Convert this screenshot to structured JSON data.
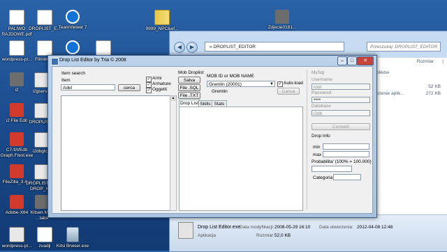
{
  "desktop": {
    "icons": [
      {
        "label": "PALIWO RAJDOWE.pdf",
        "kind": "doc"
      },
      {
        "label": "DROPLIST_E...",
        "kind": "doc"
      },
      {
        "label": "TeamViewer 7",
        "kind": "tv"
      },
      {
        "label": "9999_NPC&ef...",
        "kind": "zip"
      },
      {
        "label": "Zdjecie0181...",
        "kind": "gray"
      },
      {
        "label": "wordpress-pl...",
        "kind": "doc"
      },
      {
        "label": "Filmik003",
        "kind": "doc"
      },
      {
        "label": "",
        "kind": "tv"
      },
      {
        "label": "",
        "kind": "doc"
      },
      {
        "label": "i2",
        "kind": "gray"
      },
      {
        "label": "i2gserver",
        "kind": "exe"
      },
      {
        "label": "i2 File Edit",
        "kind": "red"
      },
      {
        "label": "DROPLIST...",
        "kind": "exe"
      },
      {
        "label": "C7-fi/t/Edit Graph.Ftest.exe",
        "kind": "red"
      },
      {
        "label": "i2dbglcut",
        "kind": "exe"
      },
      {
        "label": "FileZilla_3.4...",
        "kind": "red"
      },
      {
        "label": "DROPLIST_E... DROP_ICO",
        "kind": "exe"
      },
      {
        "label": "Adobe-X64",
        "kind": "red"
      },
      {
        "label": "Kitsen Mob ...tabs",
        "kind": "gray"
      },
      {
        "label": "wordpress-pl...",
        "kind": "exe"
      },
      {
        "label": "zuadji",
        "kind": "doc"
      },
      {
        "label": "Kitsi Brwser.exe",
        "kind": "bin"
      }
    ]
  },
  "explorer": {
    "address": "DROPLIST_EDITOR",
    "search_placeholder": "Przeszukaj: DROPLIST_EDITOR",
    "column_size": "Rozmiar",
    "rows": [
      {
        "name": "plików",
        "size": ""
      },
      {
        "name": "",
        "size": "52 KB"
      },
      {
        "name": "ożenie aplik...",
        "size": "272 KB"
      }
    ],
    "status": {
      "file_name": "Drop List Editor.exe",
      "modified_label": "Data modyfikacji:",
      "modified_value": "2008-05-29 16:10",
      "created_label": "Data utworzenia:",
      "created_value": "2012-04-08 12:48",
      "type": "Aplikacja",
      "size_label": "Rozmiar:",
      "size_value": "52,0 KB"
    }
  },
  "dialog": {
    "title": "Drop List Editor by Tria © 2008",
    "item_search": {
      "group_label": "Item search",
      "item_label": "Item",
      "item_value": "Adel",
      "search_button": "cerca",
      "checks": [
        {
          "label": "Armi",
          "checked": true
        },
        {
          "label": "Armature",
          "checked": true
        },
        {
          "label": "Oggetti",
          "checked": true
        }
      ]
    },
    "mob_droplist": {
      "group_label": "Mob Droplist",
      "save_button": "Salva",
      "file_sql_button": "File .SQL",
      "file_txt_button": "File .TXT",
      "mob_id_label": "MOB ID or MOB NAME",
      "mob_selected": "Gremlin (20001)",
      "mob_name": "Gremlin",
      "autoload_label": "Auto-load",
      "autoload_checked": true,
      "cancel_button": "Canca",
      "tabs": [
        "Drop List",
        "Skills",
        "Stats"
      ]
    },
    "mysql": {
      "group_label": "MySql",
      "username_label": "Username",
      "username_value": "root",
      "password_label": "Password",
      "password_value": "****",
      "database_label": "Database",
      "database_value": "i2db",
      "connect_button": "Connetti"
    },
    "drop_info": {
      "group_label": "Drop Info",
      "min_label": "min",
      "max_label": "max",
      "prob_label": "Probabilita' (100% = 100.000)",
      "category_label": "Categoria"
    }
  }
}
